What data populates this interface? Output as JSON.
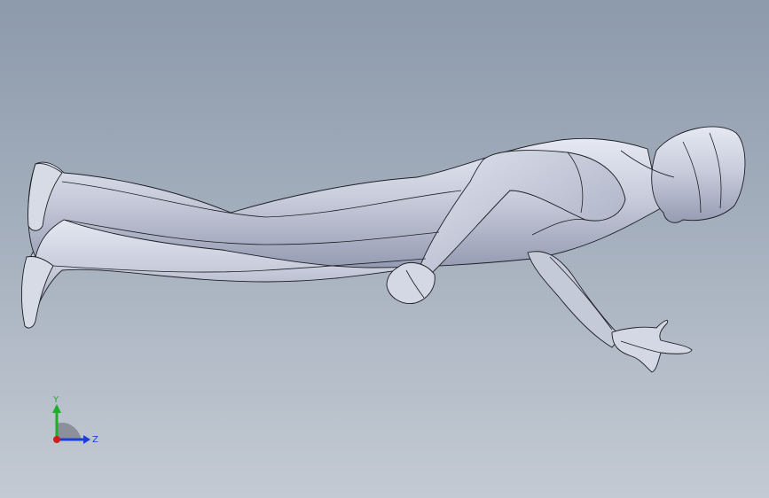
{
  "viewport": {
    "background_top": "#8d9aab",
    "background_bottom": "#c3cad3"
  },
  "model": {
    "surface_color": "#c9cddc",
    "shade_color": "#9da3ba",
    "edge_color": "#1e1f24"
  },
  "triad": {
    "y_label": "Y",
    "z_label": "Z",
    "y_color": "#1fae2a",
    "z_color": "#1a3fd6",
    "x_color": "#d11c1c"
  }
}
